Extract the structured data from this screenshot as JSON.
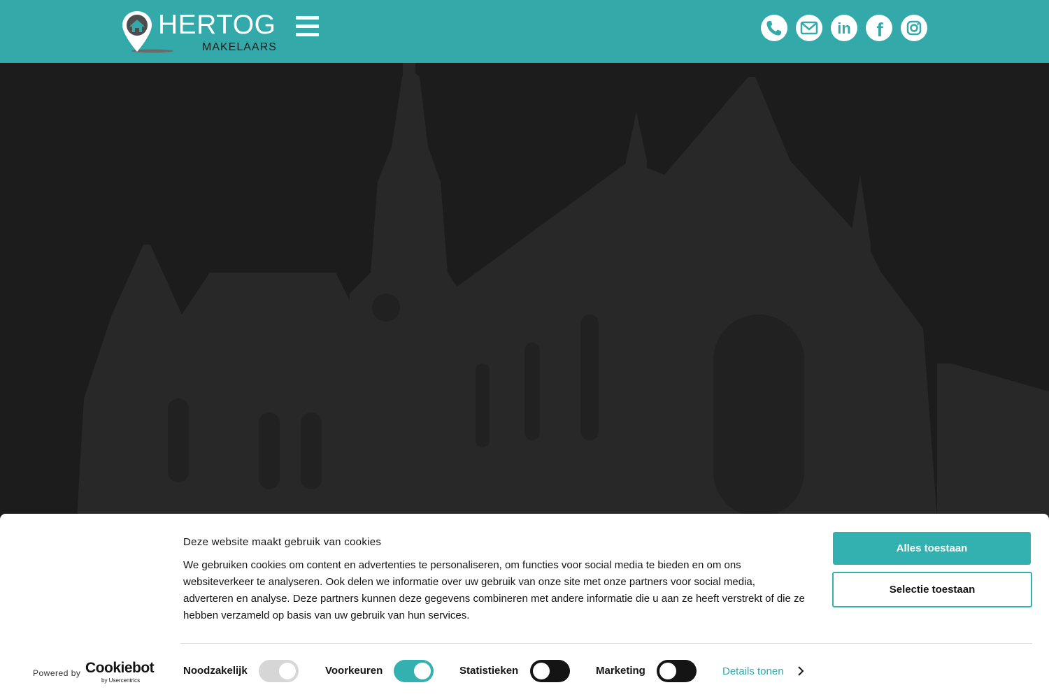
{
  "header": {
    "brand_name": "HERTOG",
    "brand_sub": "MAKELAARS",
    "accent_color": "#33a9a9",
    "menu_icon": "hamburger-menu-icon",
    "social_icons": [
      "phone-icon",
      "mail-icon",
      "linkedin-icon",
      "facebook-icon",
      "instagram-icon"
    ],
    "linkedin_glyph": "in",
    "facebook_glyph": "f"
  },
  "cookie_banner": {
    "title": "Deze website maakt gebruik van cookies",
    "body": "We gebruiken cookies om content en advertenties te personaliseren, om functies voor social media te bieden en om ons websiteverkeer te analyseren. Ook delen we informatie over uw gebruik van onze site met onze partners voor social media, adverteren en analyse. Deze partners kunnen deze gegevens combineren met andere informatie die u aan ze heeft verstrekt of die ze hebben verzameld op basis van uw gebruik van hun services.",
    "allow_all_label": "Alles toestaan",
    "allow_selection_label": "Selectie toestaan",
    "powered_by": "Powered by",
    "cookiebot_brand": "Cookiebot",
    "cookiebot_sub": "by Usercentrics",
    "toggles": [
      {
        "label": "Noodzakelijk",
        "state": "on-disabled"
      },
      {
        "label": "Voorkeuren",
        "state": "on"
      },
      {
        "label": "Statistieken",
        "state": "off"
      },
      {
        "label": "Marketing",
        "state": "off"
      }
    ],
    "details_label": "Details tonen",
    "accent_color": "#33b1b1"
  }
}
